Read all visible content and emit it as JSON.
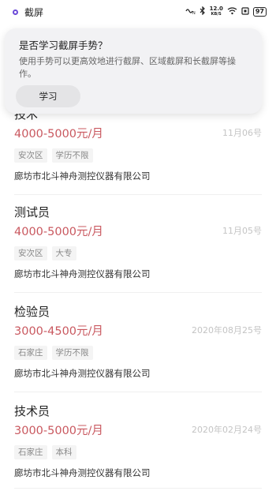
{
  "status_bar": {
    "app_name": "截屏",
    "net_speed_value": "12.0",
    "net_speed_unit": "KB/S",
    "battery": "97"
  },
  "popup": {
    "title": "是否学习截屏手势？",
    "description": "使用手势可以更高效地进行截屏、区域截屏和长截屏等操作。",
    "learn_button": "学习"
  },
  "jobs": [
    {
      "title": "技术",
      "salary": "4000-5000元/月",
      "date": "11月06号",
      "tags": [
        "安次区",
        "学历不限"
      ],
      "company": "廊坊市北斗神舟测控仪器有限公司"
    },
    {
      "title": "测试员",
      "salary": "4000-5000元/月",
      "date": "11月05号",
      "tags": [
        "安次区",
        "大专"
      ],
      "company": "廊坊市北斗神舟测控仪器有限公司"
    },
    {
      "title": "检验员",
      "salary": "3000-4500元/月",
      "date": "2020年08月25号",
      "tags": [
        "石家庄",
        "学历不限"
      ],
      "company": "廊坊市北斗神舟测控仪器有限公司"
    },
    {
      "title": "技术员",
      "salary": "3000-5000元/月",
      "date": "2020年02月24号",
      "tags": [
        "石家庄",
        "本科"
      ],
      "company": "廊坊市北斗神舟测控仪器有限公司"
    }
  ]
}
